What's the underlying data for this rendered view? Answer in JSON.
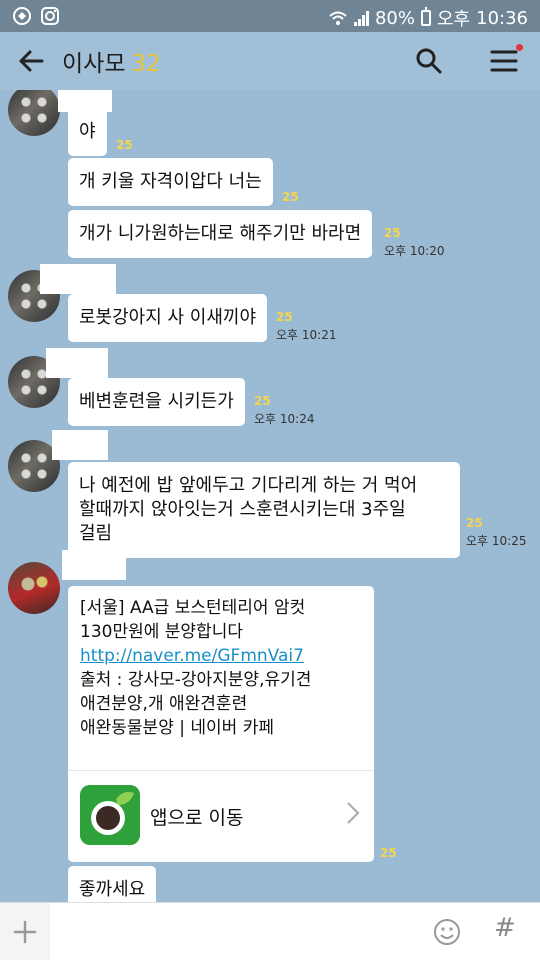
{
  "status_bar": {
    "battery": "80%",
    "ampm": "오후",
    "time": "10:36"
  },
  "header": {
    "title": "이사모",
    "member_count": "32"
  },
  "messages": [
    {
      "text": "야",
      "unread": "25"
    },
    {
      "text": "개 키울 자격이압다 너는",
      "unread": "25"
    },
    {
      "text": "개가 니가원하는대로 해주기만 바라면",
      "unread": "25",
      "time": "오후 10:20"
    },
    {
      "text": "로봇강아지 사 이새끼야",
      "unread": "25",
      "time": "오후 10:21"
    },
    {
      "text": "베변훈련을 시키든가",
      "unread": "25",
      "time": "오후 10:24"
    },
    {
      "text": "나 예전에 밥 앞에두고 기다리게 하는 거 먹어\n할때까지 앉아잇는거 스훈련시키는대 3주일\n걸림",
      "unread": "25",
      "time": "오후 10:25"
    },
    {
      "text": "좋까세요"
    }
  ],
  "link_card": {
    "text": "[서울] AA급 보스턴테리어 암컷\n130만원에 분양합니다",
    "url": "http://naver.me/GFmnVai7",
    "text2": "출처 : 강사모-강아지분양,유기견\n애견분양,개 애완견훈련\n애완동물분양 | 네이버 카페",
    "app_label": "앱으로 이동",
    "unread": "25"
  },
  "input": {
    "placeholder": ""
  },
  "icons": {
    "back": "back-arrow-icon",
    "search": "search-icon",
    "menu": "menu-icon",
    "plus": "plus-icon",
    "emoji": "emoji-icon",
    "hash": "#"
  },
  "colors": {
    "background": "#9bbbd4",
    "header": "#a1bfd6",
    "unread": "#f4d54f",
    "link": "#1a8fc7",
    "accent": "#e8c43b"
  }
}
